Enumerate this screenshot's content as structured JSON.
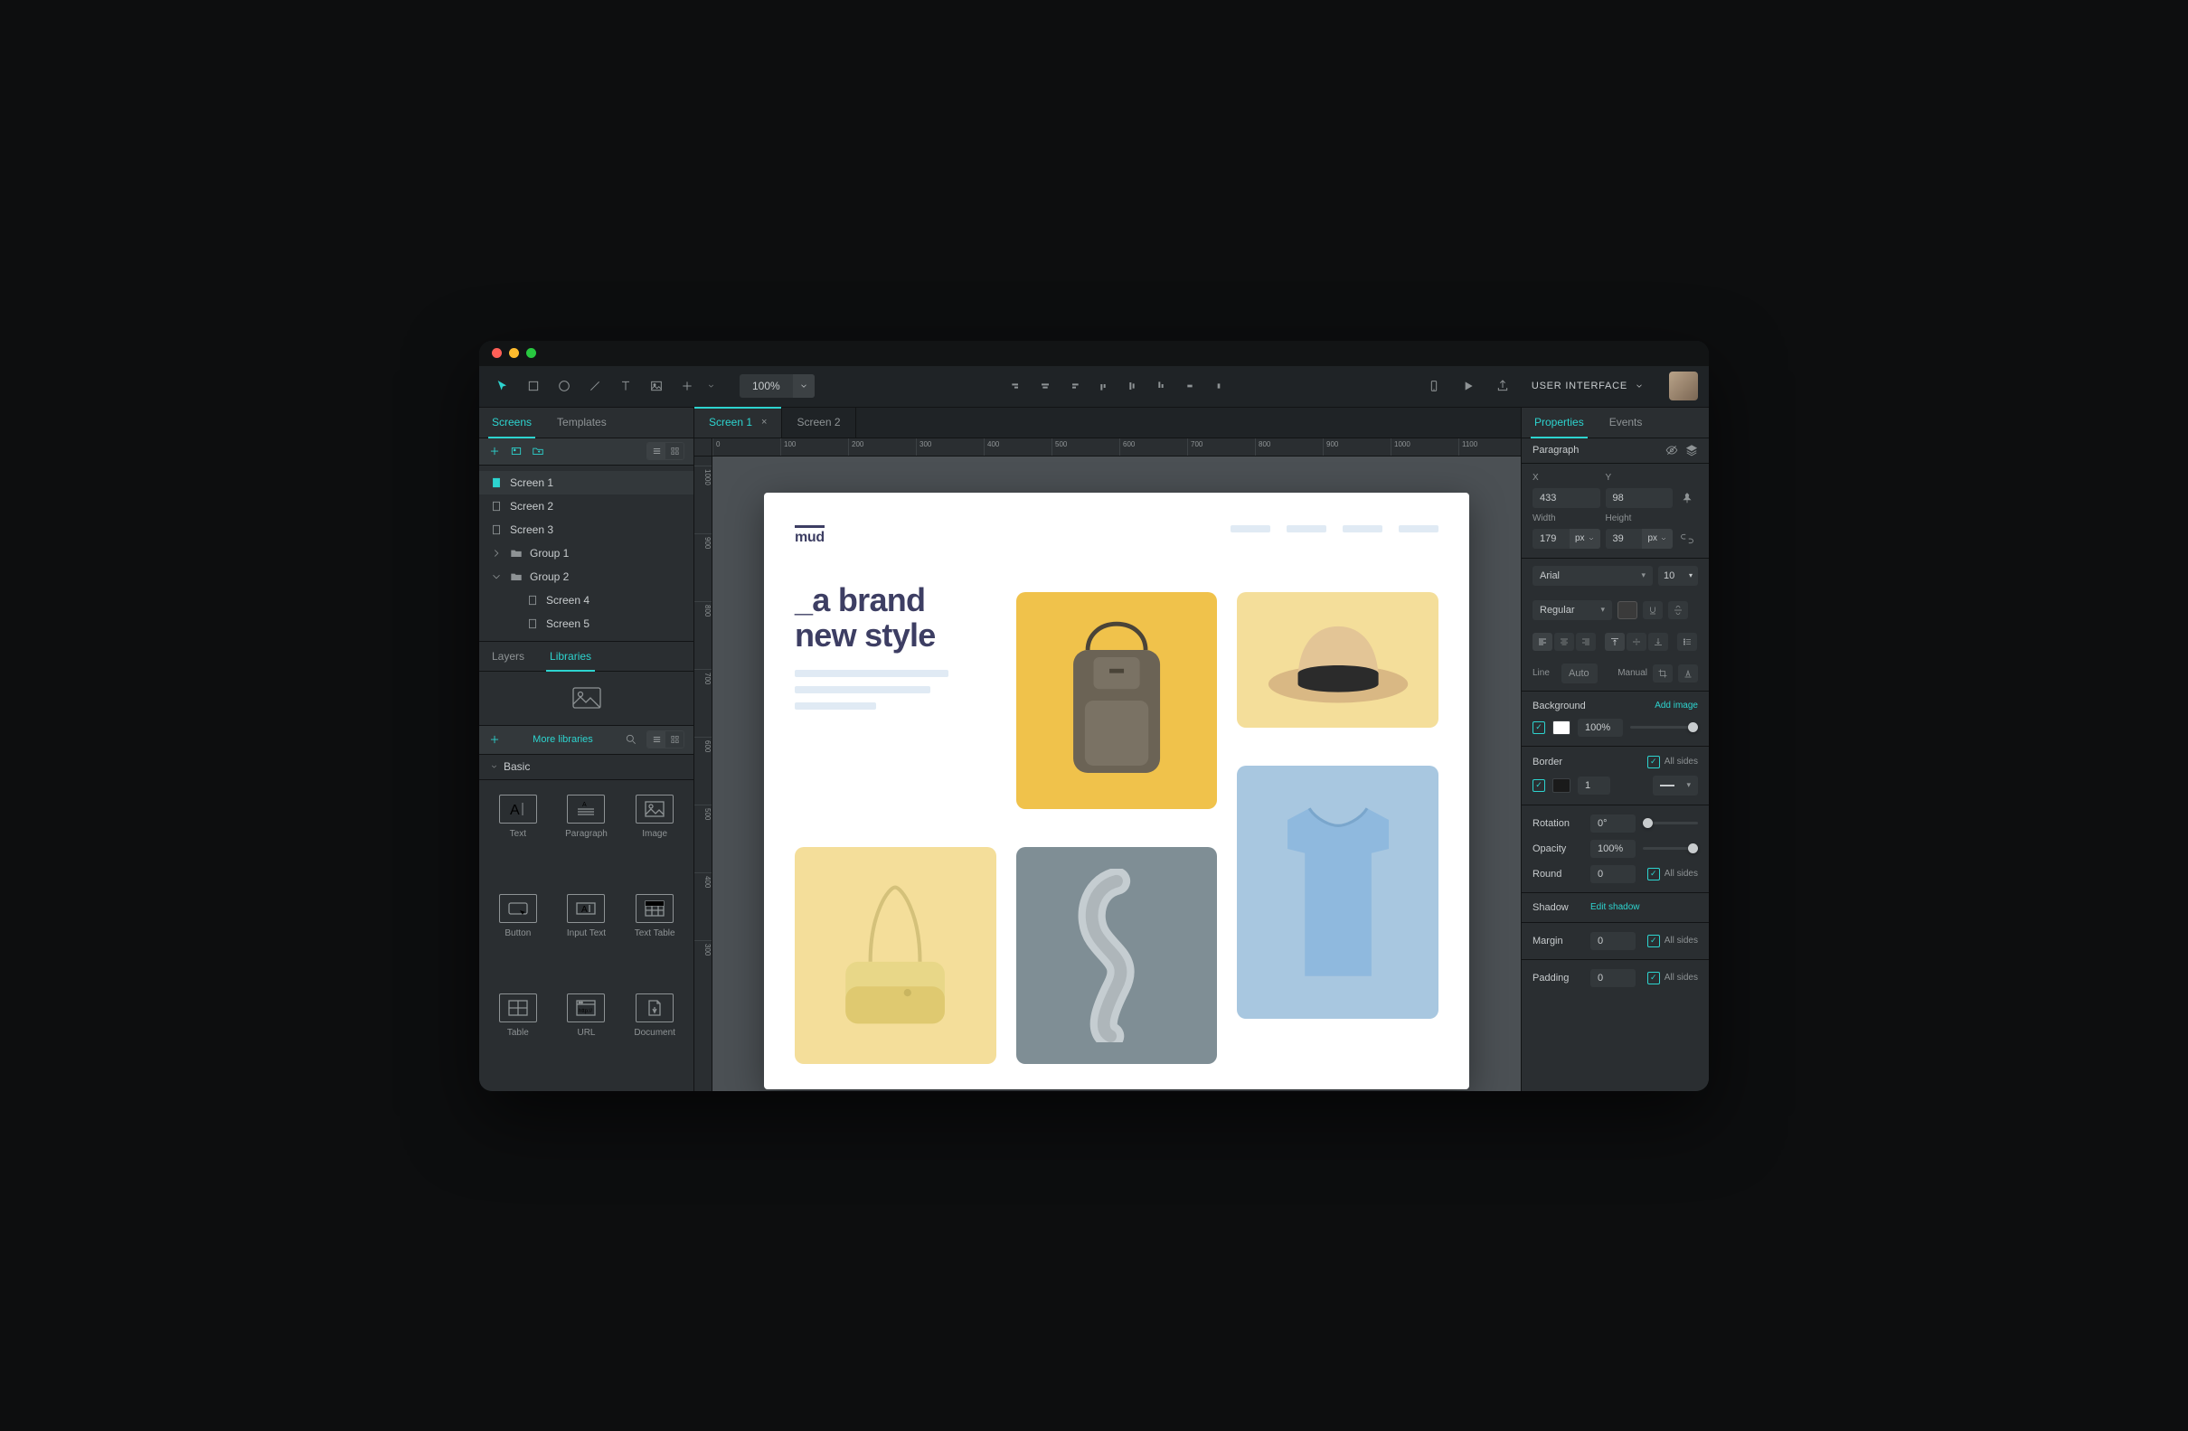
{
  "toolbar": {
    "zoom": "100%",
    "mode_label": "USER INTERFACE"
  },
  "left_panel": {
    "tabs": [
      "Screens",
      "Templates"
    ],
    "active_tab": 0,
    "tree": [
      {
        "label": "Screen 1",
        "type": "screen",
        "selected": true,
        "indent": 0
      },
      {
        "label": "Screen 2",
        "type": "screen",
        "indent": 0
      },
      {
        "label": "Screen 3",
        "type": "screen",
        "indent": 0
      },
      {
        "label": "Group 1",
        "type": "group",
        "expanded": false,
        "indent": 0
      },
      {
        "label": "Group 2",
        "type": "group",
        "expanded": true,
        "indent": 0
      },
      {
        "label": "Screen 4",
        "type": "screen",
        "indent": 1
      },
      {
        "label": "Screen 5",
        "type": "screen",
        "indent": 1
      }
    ],
    "lower_tabs": [
      "Layers",
      "Libraries"
    ],
    "lower_active": 1,
    "more_libraries": "More libraries",
    "section": "Basic",
    "widgets": [
      "Text",
      "Paragraph",
      "Image",
      "Button",
      "Input Text",
      "Text Table",
      "Table",
      "URL",
      "Document"
    ]
  },
  "doc_tabs": [
    {
      "label": "Screen 1",
      "active": true
    },
    {
      "label": "Screen 2",
      "active": false
    }
  ],
  "ruler_h": [
    0,
    100,
    200,
    300,
    400,
    500,
    600,
    700,
    800,
    900,
    1000,
    1100
  ],
  "ruler_v": [
    1000,
    900,
    800,
    700,
    600,
    500,
    400,
    300
  ],
  "artboard": {
    "logo": "mud",
    "headline_l1": "_a brand",
    "headline_l2": "new style"
  },
  "properties": {
    "tabs": [
      "Properties",
      "Events"
    ],
    "active_tab": 0,
    "selection": "Paragraph",
    "x_label": "X",
    "x": "433",
    "y_label": "Y",
    "y": "98",
    "w_label": "Width",
    "w": "179",
    "w_unit": "px",
    "h_label": "Height",
    "h": "39",
    "h_unit": "px",
    "font": "Arial",
    "font_size": "10",
    "font_weight": "Regular",
    "line_label": "Line",
    "line_auto": "Auto",
    "manual_label": "Manual",
    "bg_label": "Background",
    "add_image": "Add image",
    "bg_opacity": "100%",
    "border_label": "Border",
    "all_sides": "All sides",
    "border_w": "1",
    "rotation_label": "Rotation",
    "rotation": "0°",
    "opacity_label": "Opacity",
    "opacity": "100%",
    "round_label": "Round",
    "round": "0",
    "shadow_label": "Shadow",
    "edit_shadow": "Edit shadow",
    "margin_label": "Margin",
    "margin": "0",
    "padding_label": "Padding",
    "padding": "0"
  }
}
